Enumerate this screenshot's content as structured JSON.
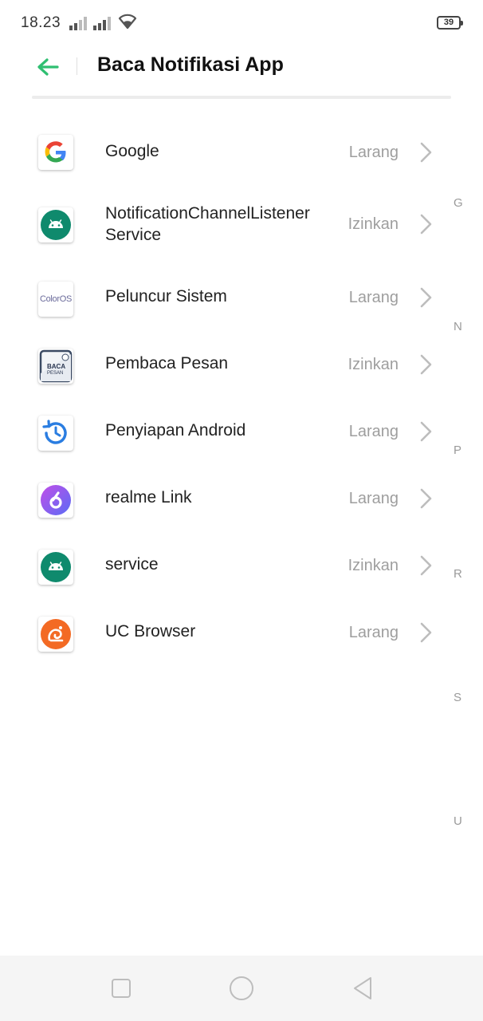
{
  "status_bar": {
    "time": "18.23",
    "battery": "39"
  },
  "header": {
    "title": "Baca Notifikasi App"
  },
  "apps": [
    {
      "name": "Google",
      "status": "Larang"
    },
    {
      "name": "NotificationChannelListener Service",
      "status": "Izinkan"
    },
    {
      "name": "Peluncur Sistem",
      "status": "Larang"
    },
    {
      "name": "Pembaca Pesan",
      "status": "Izinkan"
    },
    {
      "name": "Penyiapan Android",
      "status": "Larang"
    },
    {
      "name": "realme Link",
      "status": "Larang"
    },
    {
      "name": "service",
      "status": "Izinkan"
    },
    {
      "name": "UC Browser",
      "status": "Larang"
    }
  ],
  "icons": {
    "google": "google-icon",
    "android": "android-icon",
    "coloros": "coloros-icon",
    "pembaca": "pembaca-pesan-icon",
    "restore": "restore-clock-icon",
    "realme": "realme-link-icon",
    "uc": "uc-browser-icon"
  },
  "icon_texts": {
    "coloros": "ColorOS",
    "pembaca_line1": "BACA",
    "pembaca_line2": "PESAN"
  },
  "index_letters": [
    "G",
    "N",
    "P",
    "R",
    "S",
    "U"
  ],
  "colors": {
    "accent": "#2fbf71",
    "android_bg": "#0f8a6d",
    "realme_bg": "#8f5bf0",
    "uc_bg": "#f36a24",
    "restore": "#2a7de1"
  }
}
